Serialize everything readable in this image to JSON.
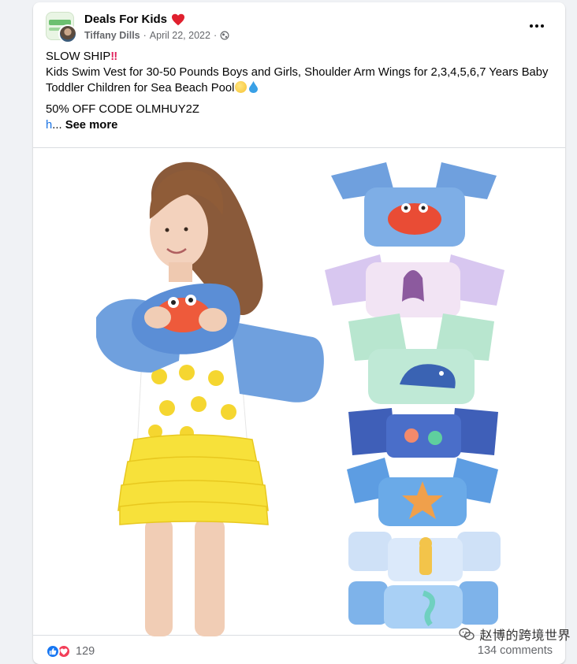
{
  "post": {
    "group_name": "Deals For Kids",
    "author": "Tiffany Dills",
    "date": "April 22, 2022",
    "separator": "·",
    "icons": {
      "group_name_suffix": "red-heart-icon",
      "audience": "globe-icon",
      "menu": "more-options-icon"
    },
    "text": {
      "line1": "SLOW SHIP",
      "line1_emoji": "‼",
      "line2": "Kids Swim Vest for 30-50 Pounds Boys and Girls, Shoulder Arm Wings for 2,3,4,5,6,7 Years Baby Toddler Children for Sea Beach Pool",
      "line3": "50% OFF CODE  OLMHUY2Z",
      "truncated_link": "h",
      "ellipsis": "...",
      "see_more": "See more"
    },
    "image": {
      "subject": "girl wearing swim vest beside seven swim vest designs",
      "vest_designs": [
        "crab",
        "mermaid",
        "dinosaur",
        "ocean friends",
        "starfish",
        "giraffe",
        "seahorse"
      ]
    },
    "reactions": {
      "types": [
        "like",
        "love"
      ],
      "count": "129"
    },
    "comments": "134 comments",
    "watermark": "赵博的跨境世界"
  },
  "colors": {
    "link": "#1b74e4",
    "secondary_text": "#65676b",
    "like_blue": "#1877f2",
    "love_red": "#f33e58",
    "vest_blue": "#6fa0de",
    "skirt_yellow": "#f7e13a"
  }
}
